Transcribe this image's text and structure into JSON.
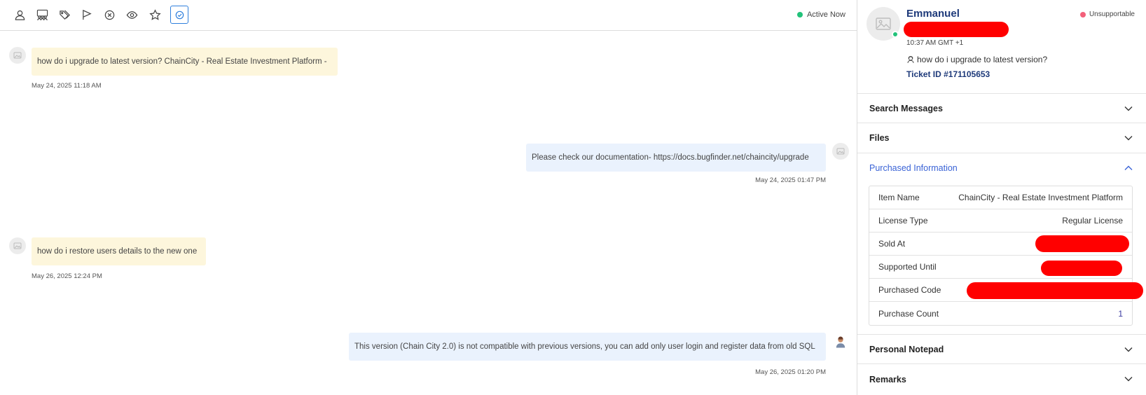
{
  "toolbar": {
    "tools": [
      "user-icon",
      "group-icon",
      "tags-icon",
      "flag-icon",
      "close-circle-icon",
      "eye-icon",
      "star-icon",
      "check-circle-icon"
    ],
    "status": "Active Now"
  },
  "messages": [
    {
      "direction": "in",
      "text": "how do i upgrade to latest version? ChainCity - Real Estate Investment Platform -",
      "time": "May 24, 2025 11:18 AM"
    },
    {
      "direction": "out",
      "text": "Please check our documentation- https://docs.bugfinder.net/chaincity/upgrade",
      "time": "May 24, 2025 01:47 PM"
    },
    {
      "direction": "in",
      "text": "how do i restore users details to the new one",
      "time": "May 26, 2025 12:24 PM"
    },
    {
      "direction": "out",
      "text": "This version (Chain City 2.0) is not compatible with previous versions, you can add only user login and register data from old SQL",
      "time": "May 26, 2025 01:20 PM"
    }
  ],
  "customer": {
    "name": "Emmanuel",
    "local_time": "10:37 AM GMT +1",
    "subject": "how do i upgrade to latest version?",
    "ticket": "Ticket ID #171105653",
    "support_status": "Unsupportable"
  },
  "sections": {
    "search": "Search Messages",
    "files": "Files",
    "purchased": "Purchased Information",
    "notepad": "Personal Notepad",
    "remarks": "Remarks"
  },
  "purchase": {
    "item_name_label": "Item Name",
    "item_name": "ChainCity - Real Estate Investment Platform",
    "license_label": "License Type",
    "license": "Regular License",
    "sold_label": "Sold At",
    "supported_label": "Supported Until",
    "code_label": "Purchased Code",
    "count_label": "Purchase Count",
    "count": "1"
  },
  "colors": {
    "accent": "#3a63d6",
    "online": "#22c27a",
    "unsupportable": "#f3607a",
    "incoming_bubble": "#fdf6dc",
    "outgoing_bubble": "#eaf2fd",
    "redaction": "#ff0000"
  }
}
